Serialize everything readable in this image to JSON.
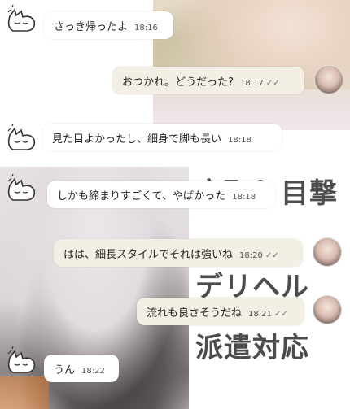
{
  "overlay_text": [
    "寝取り目撃",
    "デリヘル",
    "派遣対応"
  ],
  "colors": {
    "mine_bubble": "#f3efe4",
    "theirs_bubble": "#ffffff",
    "overlay_text": "#2d2d2d"
  },
  "messages": [
    {
      "from": "them",
      "text": "さっき帰ったよ",
      "time": "18:16"
    },
    {
      "from": "me",
      "text": "おつかれ。どうだった?",
      "time": "18:17",
      "read_icon": "double-check-icon"
    },
    {
      "from": "them",
      "text": "見た目よかったし、細身で脚も長い",
      "time": "18:18"
    },
    {
      "from": "them",
      "text": "しかも締まりすごくて、やばかった",
      "time": "18:18"
    },
    {
      "from": "me",
      "text": "はは、細長スタイルでそれは強いね",
      "time": "18:20",
      "read_icon": "double-check-icon"
    },
    {
      "from": "me",
      "text": "流れも良さそうだね",
      "time": "18:21",
      "read_icon": "double-check-icon"
    },
    {
      "from": "them",
      "text": "うん",
      "time": "18:22"
    }
  ]
}
